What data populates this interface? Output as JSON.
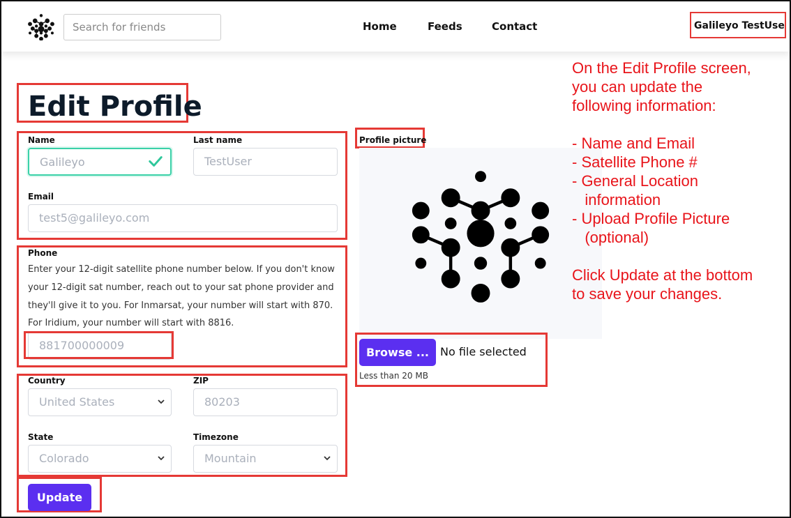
{
  "nav": {
    "search_placeholder": "Search for friends",
    "links": [
      "Home",
      "Feeds",
      "Contact"
    ],
    "user_name": "Galileyo TestUser"
  },
  "page": {
    "title": "Edit Profile"
  },
  "form": {
    "name_label": "Name",
    "name_value": "Galileyo",
    "last_name_label": "Last name",
    "last_name_value": "TestUser",
    "email_label": "Email",
    "email_value": "test5@galileyo.com",
    "phone_label": "Phone",
    "phone_help": "Enter your 12-digit satellite phone number below. If you don't know your 12-digit sat number, reach out to your sat phone provider and they'll give it to you. For Inmarsat, your number will start with 870. For Iridium, your number will start with 8816.",
    "phone_value": "881700000009",
    "country_label": "Country",
    "country_value": "United States",
    "zip_label": "ZIP",
    "zip_value": "80203",
    "state_label": "State",
    "state_value": "Colorado",
    "timezone_label": "Timezone",
    "timezone_value": "Mountain",
    "update_label": "Update"
  },
  "picture": {
    "label": "Profile picture",
    "browse_label": "Browse ...",
    "file_status": "No file selected",
    "size_hint": "Less than 20 MB"
  },
  "annotation": {
    "lines": [
      "On the Edit Profile screen,",
      "you can update the",
      "following information:",
      "",
      "- Name and Email",
      "- Satellite Phone #",
      "- General Location",
      "   information",
      "- Upload Profile Picture",
      "   (optional)",
      "",
      "Click Update at the bottom",
      "to save your changes."
    ]
  },
  "colors": {
    "accent": "#5b2ff0",
    "highlight": "#e53935",
    "annotation": "#e8141a",
    "valid": "#3ad1a8"
  },
  "icons": {
    "logo": "galileyo-logo-icon",
    "check": "checkmark-icon",
    "chevron": "chevron-down-icon"
  }
}
